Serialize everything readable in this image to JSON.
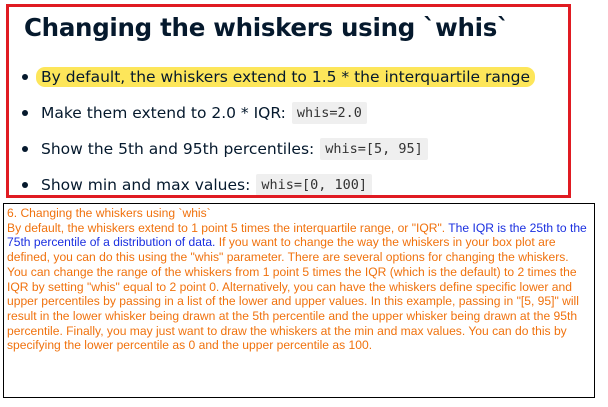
{
  "slide": {
    "title": "Changing the whiskers using `whis`",
    "bullets": [
      {
        "text": "By default, the whiskers extend to 1.5 * the interquartile range",
        "code": "",
        "highlighted": true
      },
      {
        "text": "Make them extend to 2.0 * IQR:",
        "code": "whis=2.0",
        "highlighted": false
      },
      {
        "text": "Show the 5th and 95th percentiles:",
        "code": "whis=[5, 95]",
        "highlighted": false
      },
      {
        "text": "Show min and max values:",
        "code": "whis=[0, 100]",
        "highlighted": false
      }
    ],
    "border_color": "#e01b22",
    "highlight_color": "#fde65a"
  },
  "notes": {
    "heading": "6. Changing the whiskers using `whis`",
    "text_1": "By default, the whiskers extend to 1 point 5 times the interquartile range, or \"IQR\".",
    "text_2_blue": "The IQR is the 25th to the 75th percentile of a distribution of data.",
    "text_3": "If you want to change the way the whiskers in your box plot are defined, you can do this using the \"whis\" parameter. There are several options for changing the whiskers. You can change the range of the whiskers from 1 point 5 times the IQR (which is the default) to 2 times the IQR by setting \"whis\" equal to 2 point 0. Alternatively, you can have the whiskers define specific lower and upper percentiles by passing in a list of the lower and upper values. In this example, passing in \"[5, 95]\" will result in the lower whisker being drawn at the 5th percentile and the upper whisker being drawn at the 95th percentile. Finally, you may just want to draw the whiskers at the min and max values. You can do this by specifying the lower percentile as 0 and the upper percentile as 100.",
    "text_color": "#f0720e",
    "accent_color": "#1a2fe0"
  }
}
